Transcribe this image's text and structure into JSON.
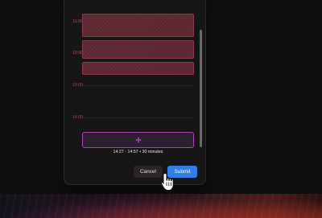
{
  "schedule": {
    "hours": [
      {
        "label": "11:00"
      },
      {
        "label": "12:00"
      },
      {
        "label": "13:00"
      },
      {
        "label": "14:00"
      }
    ],
    "selection_caption": "14:27 - 14:57  •  30 minutes"
  },
  "footer": {
    "cancel_label": "Cancel",
    "submit_label": "Submit"
  },
  "colors": {
    "accent": "#2f7fe6",
    "busy": "#5b2630",
    "selection_border": "#b040b8",
    "hour_label": "#cf4f5f"
  },
  "icons": {
    "selection": "move-icon",
    "pointer": "hand-pointer-icon"
  }
}
